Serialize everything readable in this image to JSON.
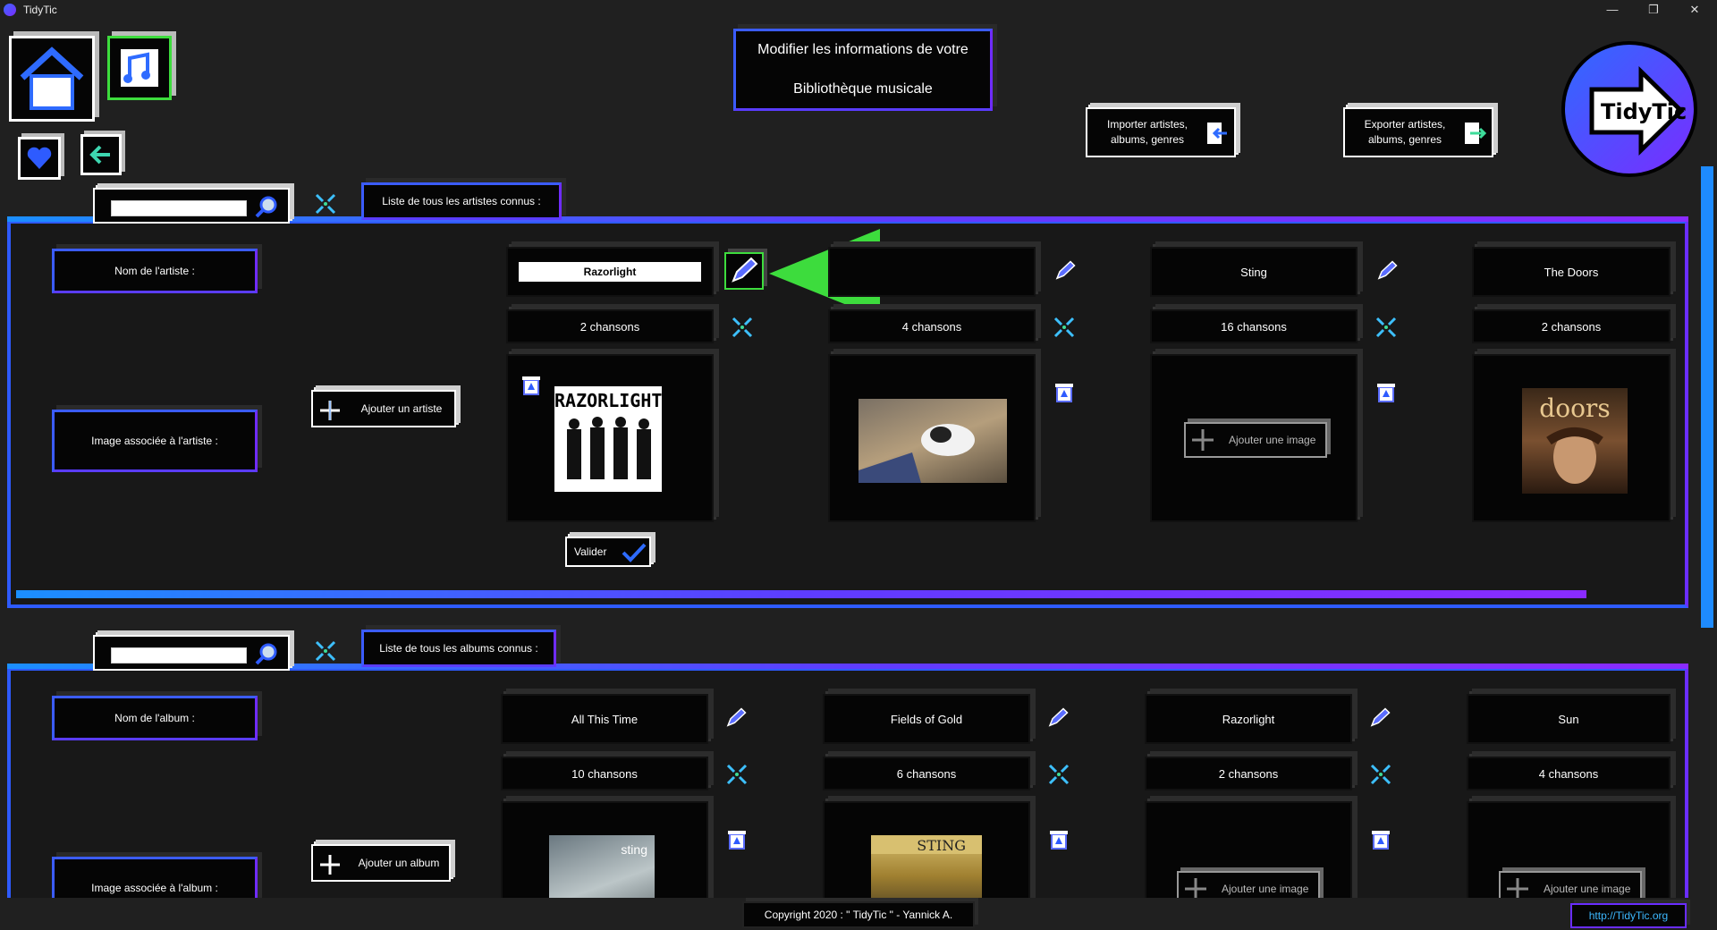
{
  "window": {
    "title": "TidyTic",
    "minimize": "—",
    "restore": "❐",
    "close": "✕"
  },
  "header": {
    "line1": "Modifier les informations de votre",
    "line2": "Bibliothèque musicale"
  },
  "buttons": {
    "import": "Importer artistes, albums, genres",
    "export": "Exporter artistes, albums, genres"
  },
  "brand": {
    "logo_text": "TidyTic"
  },
  "artists": {
    "list_title": "Liste de tous les artistes connus :",
    "search_placeholder": "",
    "name_label": "Nom de l'artiste :",
    "image_label": "Image associée à l'artiste :",
    "add_button": "Ajouter un artiste",
    "validate": "Valider",
    "items": [
      {
        "name": "Razorlight",
        "count": "2 chansons",
        "image_caption": "RAZORLIGHT"
      },
      {
        "name": "",
        "count": "4 chansons",
        "image_caption": ""
      },
      {
        "name": "Sting",
        "count": "16 chansons",
        "image_caption": "Ajouter une image"
      },
      {
        "name": "The Doors",
        "count": "2 chansons",
        "image_caption": "doors"
      }
    ]
  },
  "albums": {
    "list_title": "Liste de tous les albums connus :",
    "name_label": "Nom de l'album :",
    "image_label": "Image associée à l'album :",
    "add_button": "Ajouter un album",
    "items": [
      {
        "name": "All This Time",
        "count": "10 chansons",
        "image_caption": "sting"
      },
      {
        "name": "Fields of Gold",
        "count": "6 chansons",
        "image_caption": "STING"
      },
      {
        "name": "Razorlight",
        "count": "2 chansons",
        "image_caption": "Ajouter une image"
      },
      {
        "name": "Sun",
        "count": "4 chansons",
        "image_caption": "Ajouter une image"
      }
    ]
  },
  "footer": {
    "copyright": "Copyright 2020 : \" TidyTic \" - Yannick A.",
    "url": "http://TidyTic.org"
  },
  "colors": {
    "accent_blue": "#2e5bff",
    "accent_purple": "#7a2cff",
    "arrow_green": "#3ddc3d"
  }
}
